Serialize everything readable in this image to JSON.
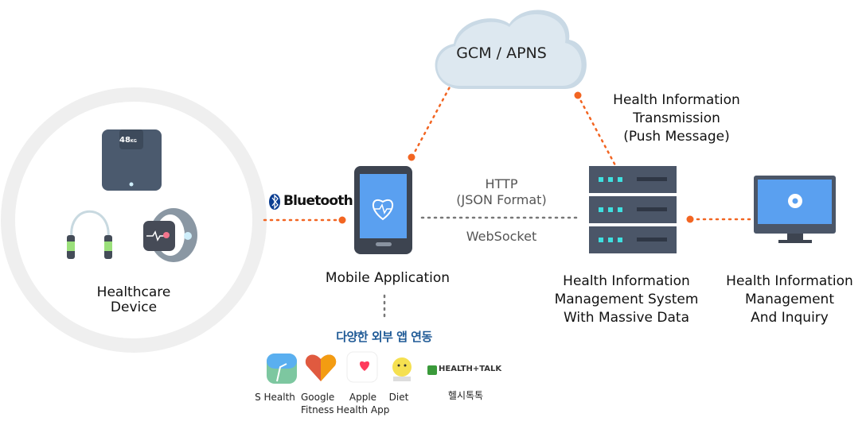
{
  "cloud": {
    "label": "GCM / APNS"
  },
  "healthcare_device": {
    "label_line1": "Healthcare",
    "label_line2": "Device",
    "scale_reading": "48",
    "scale_unit": "KG"
  },
  "bluetooth": {
    "label": "Bluetooth"
  },
  "mobile": {
    "label": "Mobile Application"
  },
  "connection": {
    "http": "HTTP",
    "format": "(JSON Format)",
    "websocket": "WebSocket"
  },
  "push": {
    "line1": "Health Information",
    "line2": "Transmission",
    "line3": "(Push Message)"
  },
  "server": {
    "line1": "Health Information",
    "line2": "Management System",
    "line3": "With Massive Data"
  },
  "monitor": {
    "line1": "Health Information",
    "line2": "Management",
    "line3": "And Inquiry"
  },
  "external_apps": {
    "title": "다양한 외부 앱 연동",
    "apps": [
      {
        "name": "S Health"
      },
      {
        "name_line1": "Google",
        "name_line2": "Fitness"
      },
      {
        "name_line1": "Apple",
        "name_line2": "Health App"
      },
      {
        "name": "Diet"
      },
      {
        "logo": "HEALTH+TALK",
        "name": "헬시톡톡"
      }
    ]
  },
  "colors": {
    "accent_orange": "#f26522",
    "title_blue": "#1f5a96",
    "cloud": "#dde8f0",
    "device_dark": "#4a5568"
  }
}
